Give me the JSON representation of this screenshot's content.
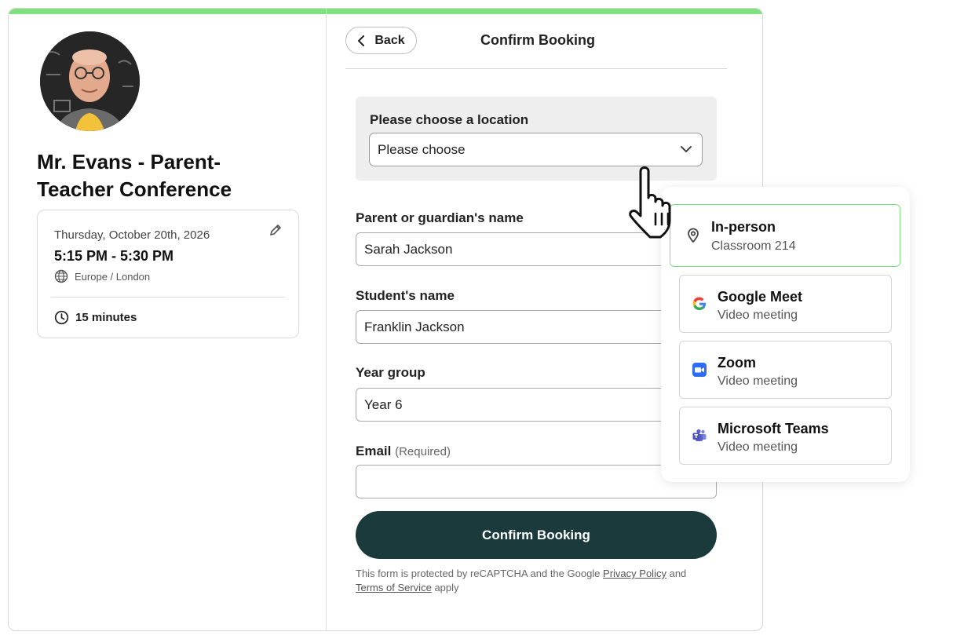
{
  "host": {
    "title": "Mr. Evans - Parent-Teacher Conference"
  },
  "event": {
    "date": "Thursday, October 20th, 2026",
    "time": "5:15 PM - 5:30 PM",
    "timezone": "Europe / London",
    "duration": "15 minutes"
  },
  "header": {
    "back_label": "Back",
    "title": "Confirm Booking"
  },
  "location": {
    "label": "Please choose a location",
    "selected": "Please choose"
  },
  "fields": {
    "guardian_label": "Parent or guardian's name",
    "guardian_value": "Sarah Jackson",
    "student_label": "Student's name",
    "student_value": "Franklin Jackson",
    "year_label": "Year group",
    "year_value": "Year 6",
    "email_label": "Email",
    "email_hint": "(Required)",
    "email_value": ""
  },
  "confirm_label": "Confirm Booking",
  "legal": {
    "prefix": "This form is protected by reCAPTCHA and the Google",
    "privacy": "Privacy Policy",
    "and": "and",
    "terms": "Terms of Service",
    "suffix": "apply"
  },
  "location_options": [
    {
      "title": "In-person",
      "subtitle": "Classroom 214",
      "icon": "map-pin-icon"
    },
    {
      "title": "Google Meet",
      "subtitle": "Video meeting",
      "icon": "google-icon"
    },
    {
      "title": "Zoom",
      "subtitle": "Video meeting",
      "icon": "zoom-icon"
    },
    {
      "title": "Microsoft Teams",
      "subtitle": "Video meeting",
      "icon": "teams-icon"
    }
  ],
  "colors": {
    "accent_green": "#7ee07e",
    "button_dark": "#1b3a3c",
    "zoom_blue": "#2d6cf6",
    "teams_purple": "#5b5fc7"
  }
}
